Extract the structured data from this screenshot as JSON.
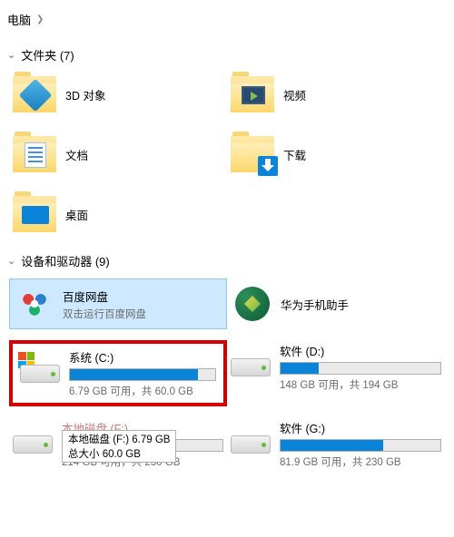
{
  "breadcrumb": {
    "root": "电脑"
  },
  "sections": {
    "folders": {
      "title": "文件夹 (7)"
    },
    "devices": {
      "title": "设备和驱动器 (9)"
    }
  },
  "folders": [
    {
      "label": "3D 对象"
    },
    {
      "label": "视频"
    },
    {
      "label": "文档"
    },
    {
      "label": "下载"
    },
    {
      "label": "桌面"
    }
  ],
  "apps": {
    "baidu": {
      "title": "百度网盘",
      "sub": "双击运行百度网盘"
    },
    "huawei": {
      "title": "华为手机助手"
    }
  },
  "drives": {
    "c": {
      "title": "系统 (C:)",
      "sub": "6.79 GB 可用，共 60.0 GB",
      "fill_pct": 88
    },
    "d": {
      "title": "软件 (D:)",
      "sub": "148 GB 可用，共 194 GB",
      "fill_pct": 24
    },
    "f": {
      "title": "本地磁盘 (F:)",
      "sub": "214 GB 可用，共 230 GB",
      "fill_pct": 7,
      "tooltip_title": "本地磁盘 (F:) 6.79 GB",
      "tooltip_size": "总大小 60.0 GB"
    },
    "g": {
      "title": "软件 (G:)",
      "sub": "81.9 GB 可用，共 230 GB",
      "fill_pct": 64
    }
  }
}
